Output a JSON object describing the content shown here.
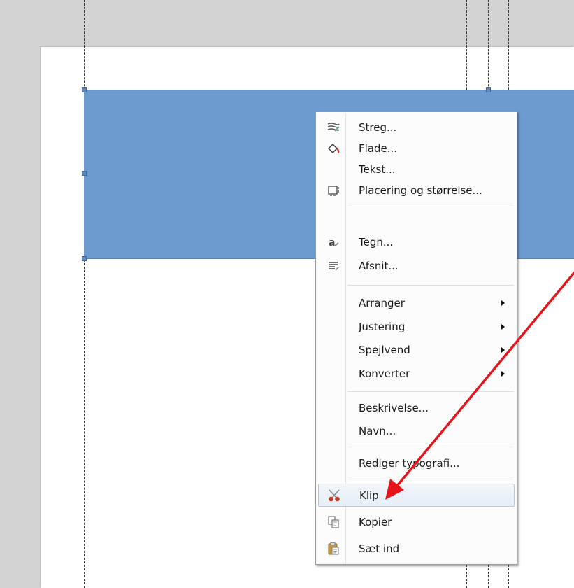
{
  "menu": {
    "items": [
      {
        "label": "Streg...",
        "icon": "line-icon"
      },
      {
        "label": "Flade...",
        "icon": "area-fill-icon"
      },
      {
        "label": "Tekst...",
        "icon": ""
      },
      {
        "label": "Placering og størrelse...",
        "icon": "position-size-icon"
      },
      {
        "label": "Tegn...",
        "icon": "character-icon"
      },
      {
        "label": "Afsnit...",
        "icon": "paragraph-icon"
      },
      {
        "label": "Arranger",
        "submenu": true
      },
      {
        "label": "Justering",
        "submenu": true
      },
      {
        "label": "Spejlvend",
        "submenu": true
      },
      {
        "label": "Konverter",
        "submenu": true
      },
      {
        "label": "Beskrivelse..."
      },
      {
        "label": "Navn..."
      },
      {
        "label": "Rediger typografi..."
      },
      {
        "label": "Klip",
        "icon": "scissors-icon",
        "highlighted": true
      },
      {
        "label": "Kopier",
        "icon": "copy-icon"
      },
      {
        "label": "Sæt ind",
        "icon": "paste-icon"
      }
    ]
  },
  "colors": {
    "background": "#d3d3d3",
    "shape_fill": "#6d9bcf",
    "arrow": "#e8141b",
    "menu_highlight": "#e6eef8"
  }
}
